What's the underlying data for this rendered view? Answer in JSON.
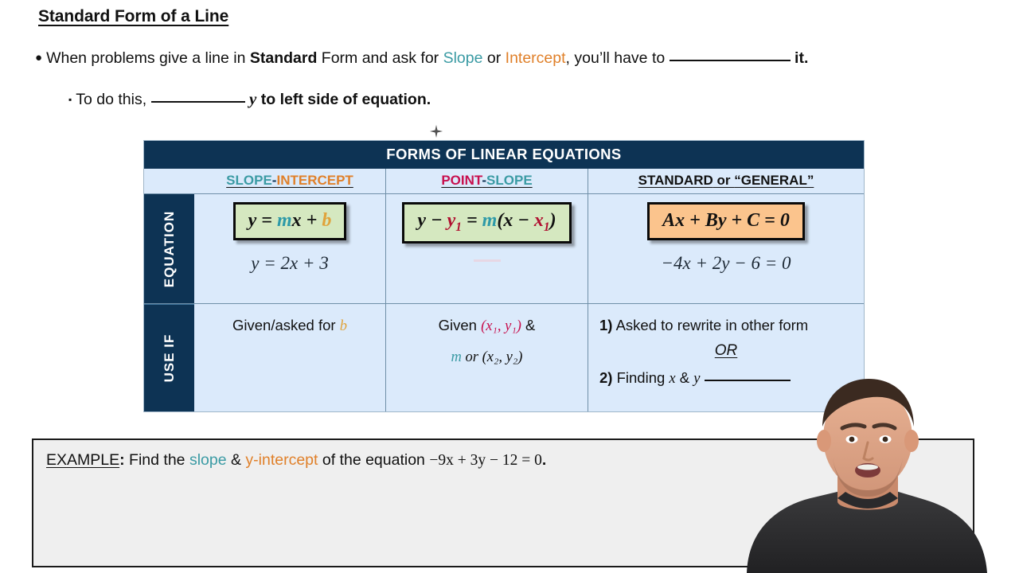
{
  "slide": {
    "title": "Standard Form of a Line",
    "bullets": {
      "level1": {
        "marker": "●",
        "pre": "When problems give a line in ",
        "bold_word": "Standard",
        "mid1": " Form and ask for ",
        "slope_word": "Slope",
        "mid2": " or ",
        "intercept_word": "Intercept",
        "mid3": ", you’ll have to ",
        "post": " it."
      },
      "level2": {
        "marker": "▪",
        "pre": "To do this, ",
        "var": "y",
        "post": " to left side of equation."
      }
    }
  },
  "table": {
    "title": "FORMS OF LINEAR EQUATIONS",
    "row_labels": {
      "equation": "EQUATION",
      "use_if": "USE IF"
    },
    "columns": [
      {
        "head_part1": "SLOPE",
        "head_sep": "-",
        "head_part2": "INTERCEPT",
        "formula": "y = mx + b",
        "formula_parts": {
          "y": "y",
          "eq": " = ",
          "m": "m",
          "x": "x",
          "plus": " + ",
          "b": "b"
        },
        "example_equation": "y = 2x + 3",
        "use_if": "Given/asked for b",
        "use_if_parts": {
          "text": "Given/asked for ",
          "var": "b"
        }
      },
      {
        "head_part1": "POINT",
        "head_sep": "-",
        "head_part2": "SLOPE",
        "formula": "y − y₁ = m(x − x₁)",
        "formula_parts": {
          "y": "y",
          "minus": " − ",
          "y1": "y",
          "y1sub": "1",
          "eq": " = ",
          "m": "m",
          "open": "(",
          "x": "x",
          "x1": "x",
          "x1sub": "1",
          "close": ")"
        },
        "example_equation": "",
        "use_if_line1_pre": "Given ",
        "use_if_line1_pair": "(x₁, y₁)",
        "use_if_line1_post": " &",
        "use_if_line2_m": "m",
        "use_if_line2_mid": " or ",
        "use_if_line2_pair": "(x₂, y₂)"
      },
      {
        "head_part1": "STANDARD",
        "head_sep": " or ",
        "head_part2": "“GENERAL”",
        "formula": "Ax + By + C = 0",
        "example_equation": "−4x + 2y − 6 = 0",
        "use_if_item1_num": "1)",
        "use_if_item1": " Asked to rewrite in other form",
        "use_if_or": "OR",
        "use_if_item2_num": "2)",
        "use_if_item2_pre": " Finding ",
        "use_if_item2_x": "x",
        "use_if_item2_amp": " & ",
        "use_if_item2_y": "y"
      }
    ]
  },
  "example": {
    "label": "EXAMPLE",
    "colon": ": ",
    "pre": "Find the ",
    "slope_word": "slope",
    "mid": " & ",
    "intercept_word": "y-intercept",
    "post": " of the equation ",
    "equation": "−9x + 3y − 12 = 0",
    "period": "."
  },
  "colors": {
    "navy": "#0d3354",
    "cell_blue": "#dbeafb",
    "teal": "#3b9ba4",
    "orange": "#e0802a",
    "crimson": "#c8104e",
    "box_green": "#d5e8c0",
    "box_orange": "#fbc48d",
    "example_bg": "#efefef"
  },
  "overlay": {
    "type": "instructor-video"
  }
}
